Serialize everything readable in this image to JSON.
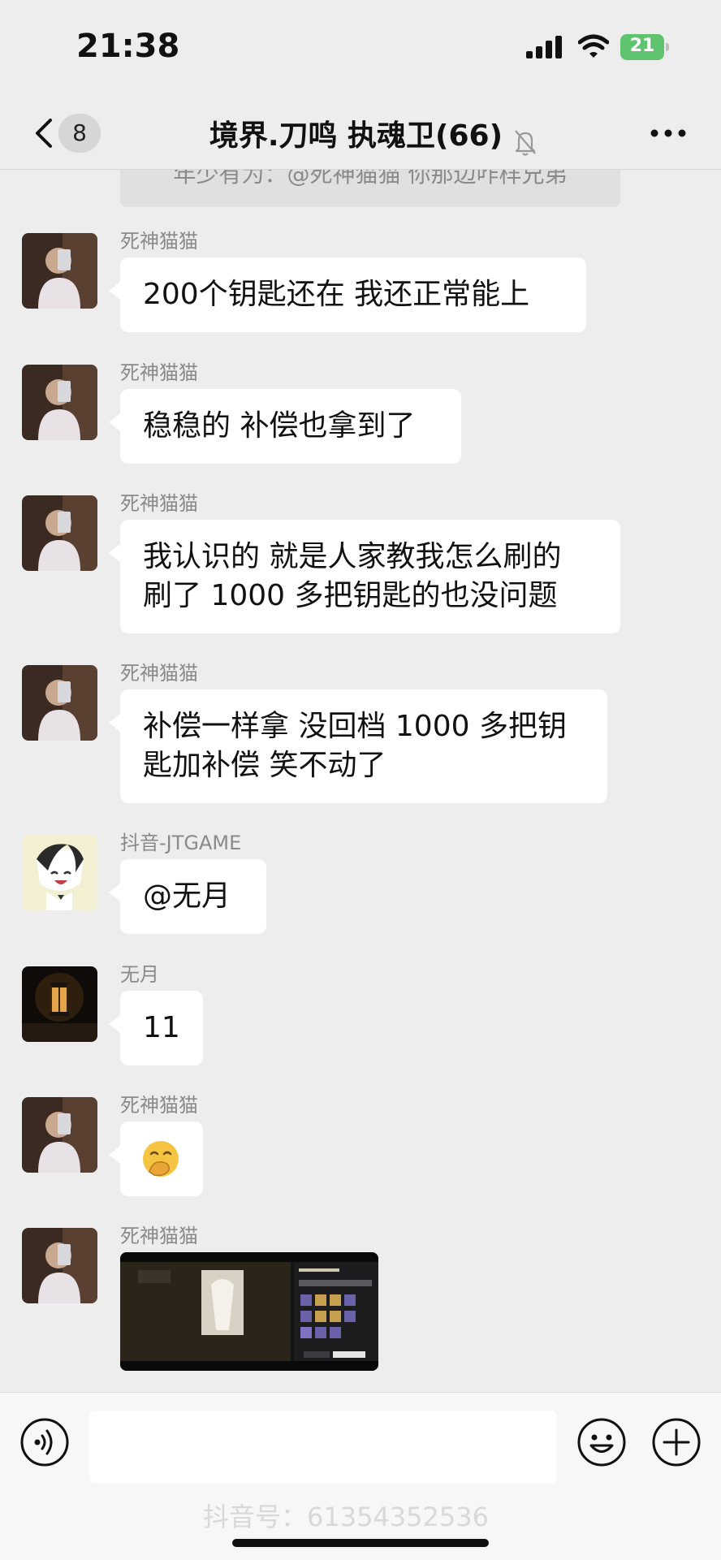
{
  "status_bar": {
    "time": "21:38",
    "battery": "21"
  },
  "header": {
    "unread_count": "8",
    "title": "境界.刀鸣 执魂卫(66)"
  },
  "system_message": "年少有为：@死神猫猫 你那边咋样兄弟",
  "messages": [
    {
      "sender": "死神猫猫",
      "text": "200个钥匙还在 我还正常能上"
    },
    {
      "sender": "死神猫猫",
      "text": "稳稳的 补偿也拿到了"
    },
    {
      "sender": "死神猫猫",
      "text": "我认识的 就是人家教我怎么刷的\n刷了 1000 多把钥匙的也没问题"
    },
    {
      "sender": "死神猫猫",
      "text": "补偿一样拿 没回档 1000 多把钥\n匙加补偿 笑不动了"
    },
    {
      "sender": "抖音-JTGAME",
      "text": "@无月"
    },
    {
      "sender": "无月",
      "text": "11"
    },
    {
      "sender": "死神猫猫",
      "emoji": "smirk-hand-over-mouth"
    },
    {
      "sender": "死神猫猫",
      "image": "game-screenshot"
    }
  ],
  "footer": {
    "watermark": "抖音号：61354352536"
  },
  "colors": {
    "background": "#ededed",
    "bubble": "#ffffff",
    "battery": "#5fc36f"
  }
}
